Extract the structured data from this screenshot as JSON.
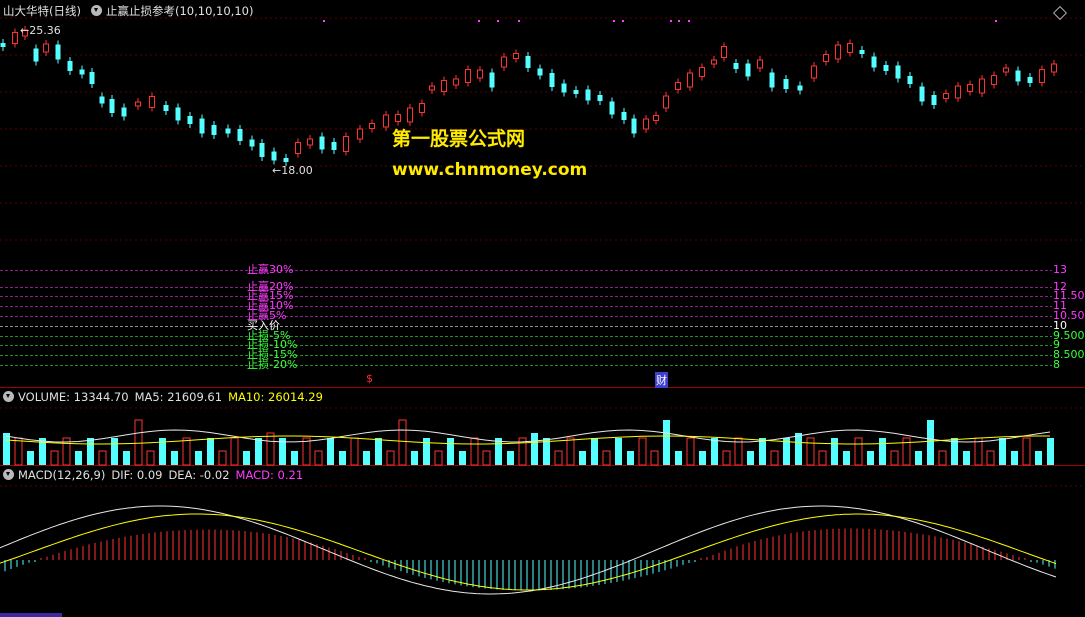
{
  "main": {
    "stock_name": "山大华特",
    "period": "(日线)",
    "indicator": "止赢止损参考(10,10,10,10)",
    "high_label": "25.36",
    "low_label": "18.00",
    "watermark_title": "第一股票公式网",
    "watermark_url": "www.chnmoney.com",
    "marker_s": "$",
    "marker_cai": "财"
  },
  "levels": [
    {
      "label": "止赢30%",
      "value": "13",
      "color": "#ff3cff"
    },
    {
      "label": "止赢20%",
      "value": "12",
      "color": "#ff3cff"
    },
    {
      "label": "止赢15%",
      "value": "11.50",
      "color": "#ff3cff"
    },
    {
      "label": "止赢10%",
      "value": "11",
      "color": "#ff3cff"
    },
    {
      "label": "止赢5%",
      "value": "10.50",
      "color": "#ff3cff"
    },
    {
      "label": "买入价",
      "value": "10",
      "color": "#ffffff"
    },
    {
      "label": "止损-5%",
      "value": "9.500",
      "color": "#3cff3c"
    },
    {
      "label": "止损-10%",
      "value": "9",
      "color": "#3cff3c"
    },
    {
      "label": "止损-15%",
      "value": "8.500",
      "color": "#3cff3c"
    },
    {
      "label": "止损-20%",
      "value": "8",
      "color": "#3cff3c"
    }
  ],
  "volume": {
    "label": "VOLUME: 13344.70",
    "ma5": "MA5: 21609.61",
    "ma10": "MA10: 26014.29"
  },
  "macd": {
    "label": "MACD(12,26,9)",
    "dif": "DIF: 0.09",
    "dea": "DEA: -0.02",
    "macd": "MACD: 0.21"
  },
  "colors": {
    "up": "#ff3232",
    "down": "#54ffff",
    "magenta": "#ff3cff",
    "green": "#3cff3c",
    "yellow": "#ffff00",
    "grid_red": "#7a0000"
  }
}
